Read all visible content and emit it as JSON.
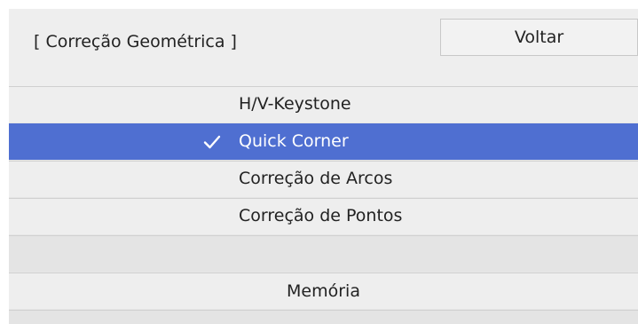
{
  "header": {
    "title": "[ Correção Geométrica ]",
    "back_label": "Voltar"
  },
  "menu": {
    "items": [
      {
        "label": "H/V-Keystone",
        "selected": false
      },
      {
        "label": "Quick Corner",
        "selected": true,
        "icon": "check-icon"
      },
      {
        "label": "Correção de Arcos",
        "selected": false
      },
      {
        "label": "Correção de Pontos",
        "selected": false
      }
    ],
    "memory_label": "Memória"
  },
  "colors": {
    "selection": "#4f6fd1",
    "row_background": "#eeeeee",
    "text": "#222222"
  }
}
